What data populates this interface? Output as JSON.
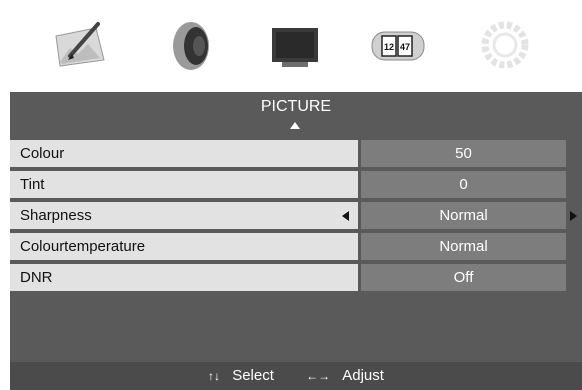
{
  "icons": [
    {
      "name": "picture-menu-icon",
      "selected": false
    },
    {
      "name": "sound-menu-icon",
      "selected": false
    },
    {
      "name": "display-menu-icon",
      "selected": true
    },
    {
      "name": "timer-menu-icon",
      "selected": false
    },
    {
      "name": "setup-menu-icon",
      "selected": false
    }
  ],
  "menu": {
    "title": "PICTURE",
    "rows": [
      {
        "label": "Colour",
        "value": "50"
      },
      {
        "label": "Tint",
        "value": "0"
      },
      {
        "label": "Sharpness",
        "value": "Normal"
      },
      {
        "label": "Colourtemperature",
        "value": "Normal"
      },
      {
        "label": "DNR",
        "value": "Off"
      }
    ],
    "selected_row": "Sharpness"
  },
  "footer": {
    "select_glyph": "↑↓",
    "select_label": "Select",
    "adjust_glyph": "←→",
    "adjust_label": "Adjust"
  },
  "timer_icon_text": [
    "12",
    "47"
  ],
  "colors": {
    "panel": "#5a5a5a",
    "label_bg": "#e2e2e2",
    "value_bg": "#7d7d7d",
    "footer_bg": "#4b4b4b"
  }
}
